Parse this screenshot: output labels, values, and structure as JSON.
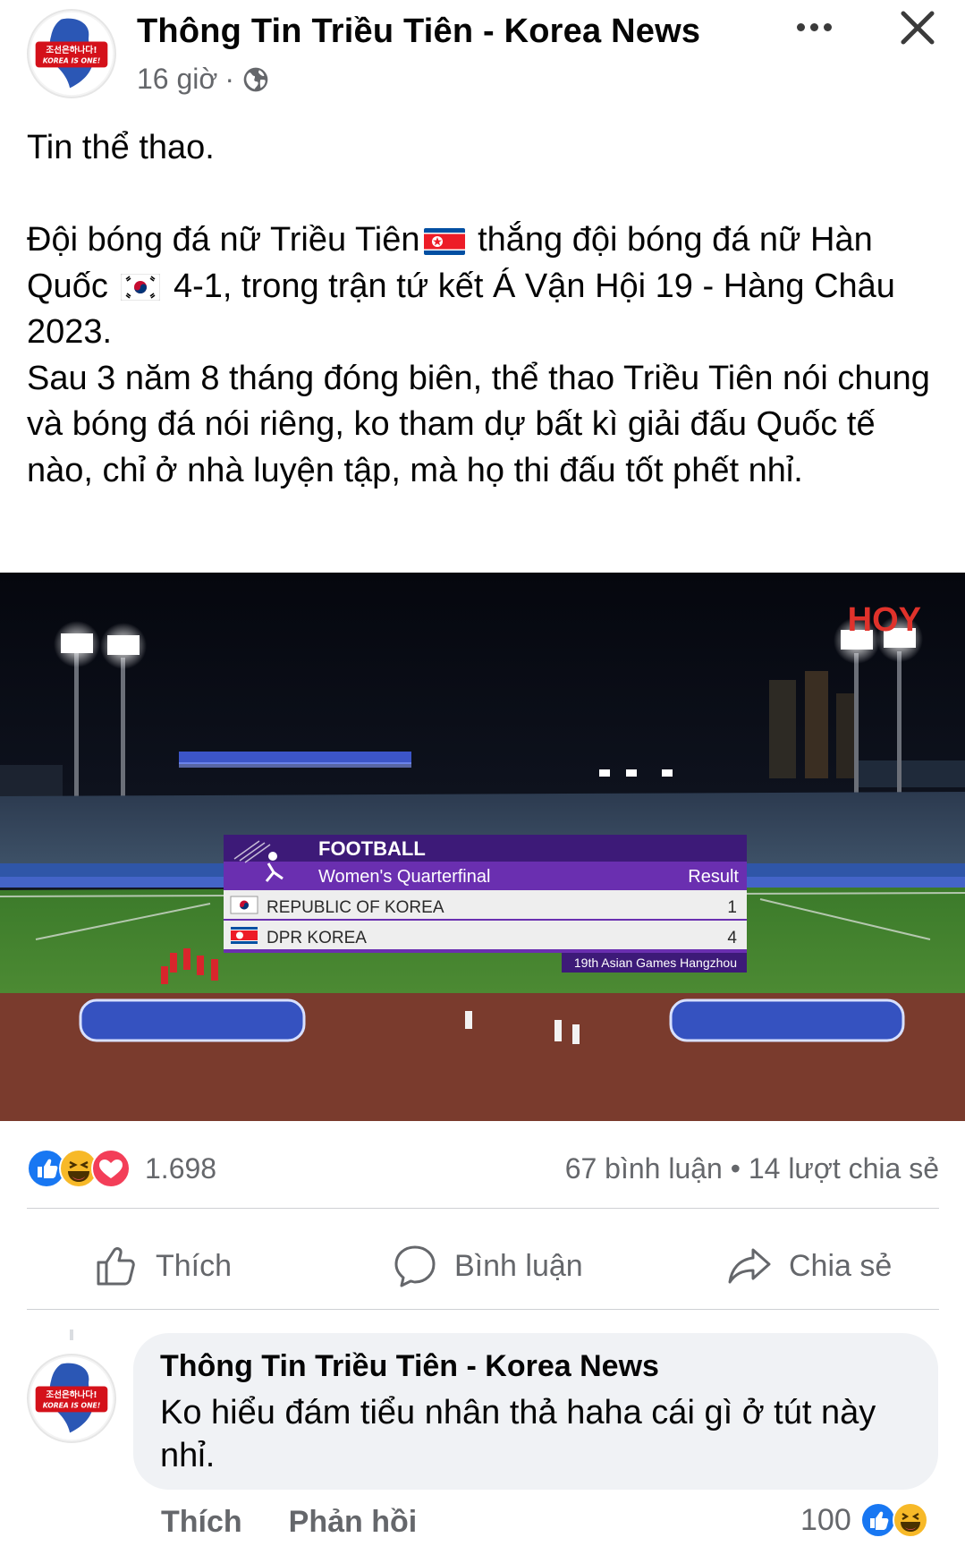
{
  "header": {
    "page_name": "Thông Tin Triều Tiên - Korea News",
    "time": "16 giờ",
    "separator": "·",
    "avatar_text_top": "조선은하나다!",
    "avatar_text_bottom": "KOREA IS ONE!"
  },
  "post": {
    "line1": "Tin thể thao.",
    "para2_a": "Đội bóng đá nữ Triều Tiên",
    "para2_b": "thắng đội bóng đá nữ Hàn Quốc",
    "para2_c": "4-1, trong trận tứ kết Á Vận Hội 19 - Hàng Châu 2023.",
    "para3": "Sau 3 năm 8 tháng đóng biên, thể thao Triều Tiên nói chung và bóng đá nói riêng, ko tham dự bất kì giải đấu Quốc tế nào, chỉ ở nhà luyện tập, mà họ thi đấu tốt phết nhỉ."
  },
  "image": {
    "broadcaster": "HOY",
    "sport": "FOOTBALL",
    "round": "Women's Quarterfinal",
    "result_label": "Result",
    "teams": [
      {
        "name": "REPUBLIC OF KOREA",
        "score": "1"
      },
      {
        "name": "DPR KOREA",
        "score": "4"
      }
    ],
    "footer": "19th Asian Games Hangzhou"
  },
  "reactions": {
    "count": "1.698",
    "comments": "67 bình luận",
    "dot": "•",
    "shares": "14 lượt chia sẻ"
  },
  "actions": {
    "like": "Thích",
    "comment": "Bình luận",
    "share": "Chia sẻ"
  },
  "comment": {
    "author": "Thông Tin Triều Tiên - Korea News",
    "text": "Ko hiểu đám tiểu nhân thả haha cái gì ở tút này nhỉ.",
    "like": "Thích",
    "reply": "Phản hồi",
    "reaction_count": "100"
  },
  "colors": {
    "facebook_blue": "#1877f2",
    "muted_text": "#65676b",
    "bubble_bg": "#f0f2f5",
    "scoreboard_purple": "#3d1a78"
  }
}
